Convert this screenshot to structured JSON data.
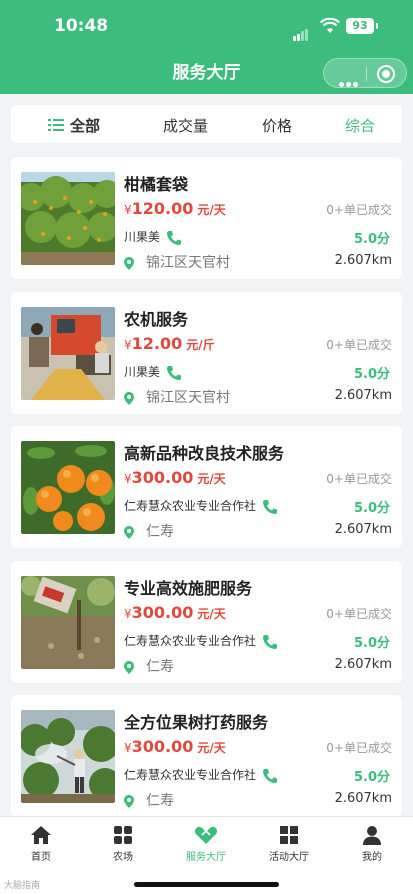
{
  "status_bar": {
    "time": "10:48",
    "battery": "93"
  },
  "nav": {
    "title": "服务大厅"
  },
  "sort": {
    "all": "全部",
    "volume": "成交量",
    "price": "价格",
    "overall": "综合"
  },
  "cards": [
    {
      "name": "柑橘套袋",
      "currency": "¥",
      "price": "120.00",
      "unit": "元/天",
      "sold": "0+单已成交",
      "provider": "川果美",
      "score": "5.0分",
      "location": "锦江区天官村",
      "distance": "2.607km"
    },
    {
      "name": "农机服务",
      "currency": "¥",
      "price": "12.00",
      "unit": "元/斤",
      "sold": "0+单已成交",
      "provider": "川果美",
      "score": "5.0分",
      "location": "锦江区天官村",
      "distance": "2.607km"
    },
    {
      "name": "高新品种改良技术服务",
      "currency": "¥",
      "price": "300.00",
      "unit": "元/天",
      "sold": "0+单已成交",
      "provider": "仁寿慧众农业专业合作社",
      "score": "5.0分",
      "location": "仁寿",
      "distance": "2.607km"
    },
    {
      "name": "专业高效施肥服务",
      "currency": "¥",
      "price": "300.00",
      "unit": "元/天",
      "sold": "0+单已成交",
      "provider": "仁寿慧众农业专业合作社",
      "score": "5.0分",
      "location": "仁寿",
      "distance": "2.607km"
    },
    {
      "name": "全方位果树打药服务",
      "currency": "¥",
      "price": "300.00",
      "unit": "元/天",
      "sold": "0+单已成交",
      "provider": "仁寿慧众农业专业合作社",
      "score": "5.0分",
      "location": "仁寿",
      "distance": "2.607km"
    }
  ],
  "tabs": {
    "home": "首页",
    "farm": "农场",
    "service": "服务大厅",
    "activity": "活动大厅",
    "mine": "我的"
  },
  "watermark": "大脑指南",
  "colors": {
    "brand": "#3cbd7e",
    "price": "#e0493e"
  }
}
